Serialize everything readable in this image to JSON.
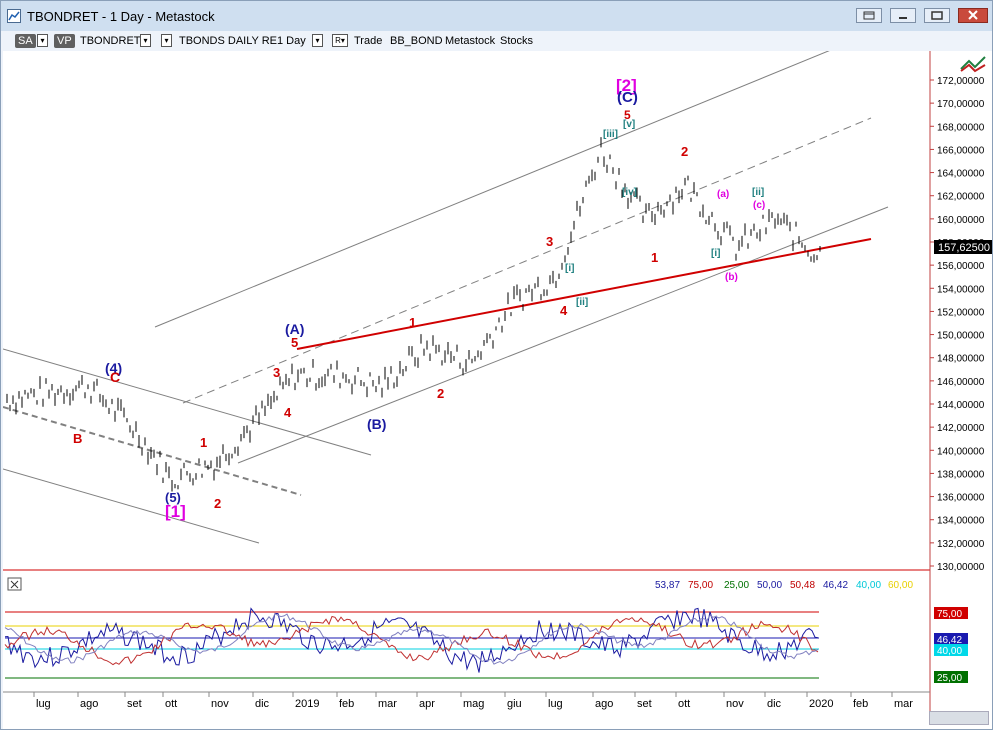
{
  "window": {
    "title": "TBONDRET - 1 Day - Metastock"
  },
  "toolbar": {
    "sa_label": "SA",
    "vp_label": "VP",
    "symbol": "TBONDRET",
    "security_name": "TBONDS DAILY RE",
    "period": "1 Day",
    "trade_label": "Trade",
    "expert": "BB_BOND",
    "app": "Metastock",
    "category": "Stocks"
  },
  "price_axis": {
    "labels": [
      "172,00000",
      "170,00000",
      "168,00000",
      "166,00000",
      "164,00000",
      "162,00000",
      "160,00000",
      "158,00000",
      "156,00000",
      "154,00000",
      "152,00000",
      "150,00000",
      "148,00000",
      "146,00000",
      "144,00000",
      "142,00000",
      "140,00000",
      "138,00000",
      "136,00000",
      "134,00000",
      "132,00000",
      "130,00000"
    ],
    "last_price": "157,62500"
  },
  "indicator_legend": [
    {
      "text": "53,87",
      "color": "#1a1aa0"
    },
    {
      "text": "75,00",
      "color": "#c00000"
    },
    {
      "text": "25,00",
      "color": "#007000"
    },
    {
      "text": "50,00",
      "color": "#1a1aa0"
    },
    {
      "text": "50,48",
      "color": "#c00000"
    },
    {
      "text": "46,42",
      "color": "#1a1aa0"
    },
    {
      "text": "40,00",
      "color": "#00c8d8"
    },
    {
      "text": "60,00",
      "color": "#e8d000"
    }
  ],
  "indicator_axis": {
    "labels": [
      {
        "text": "75,00",
        "bg": "#d00000",
        "fg": "#ffffff"
      },
      {
        "text": "46,42",
        "bg": "#1a1ab0",
        "fg": "#ffffff"
      },
      {
        "text": "40,00",
        "bg": "#00d8e8",
        "fg": "#ffffff"
      },
      {
        "text": "25,00",
        "bg": "#007000",
        "fg": "#ffffff"
      }
    ]
  },
  "time_axis": {
    "labels": [
      "lug",
      "ago",
      "set",
      "ott",
      "nov",
      "dic",
      "2019",
      "feb",
      "mar",
      "apr",
      "mag",
      "giu",
      "lug",
      "ago",
      "set",
      "ott",
      "nov",
      "dic",
      "2020",
      "feb",
      "mar"
    ]
  },
  "wave_labels": [
    {
      "text": "(4)",
      "color": "#1a1aa0"
    },
    {
      "text": "C",
      "color": "#d00000"
    },
    {
      "text": "B",
      "color": "#d00000"
    },
    {
      "text": "1",
      "color": "#d00000"
    },
    {
      "text": "(5)",
      "color": "#1a1aa0"
    },
    {
      "text": "[1]",
      "color": "#e000e0"
    },
    {
      "text": "2",
      "color": "#d00000"
    },
    {
      "text": "(A)",
      "color": "#1a1aa0"
    },
    {
      "text": "5",
      "color": "#d00000"
    },
    {
      "text": "3",
      "color": "#d00000"
    },
    {
      "text": "4",
      "color": "#d00000"
    },
    {
      "text": "(B)",
      "color": "#1a1aa0"
    },
    {
      "text": "1",
      "color": "#d00000"
    },
    {
      "text": "2",
      "color": "#d00000"
    },
    {
      "text": "3",
      "color": "#d00000"
    },
    {
      "text": "[i]",
      "color": "#208080"
    },
    {
      "text": "4",
      "color": "#d00000"
    },
    {
      "text": "[ii]",
      "color": "#208080"
    },
    {
      "text": "[2]",
      "color": "#e000e0"
    },
    {
      "text": "(C)",
      "color": "#1a1aa0"
    },
    {
      "text": "5",
      "color": "#d00000"
    },
    {
      "text": "[iii]",
      "color": "#208080"
    },
    {
      "text": "[v]",
      "color": "#208080"
    },
    {
      "text": "[iv]",
      "color": "#208080"
    },
    {
      "text": "1",
      "color": "#d00000"
    },
    {
      "text": "2",
      "color": "#d00000"
    },
    {
      "text": "(a)",
      "color": "#e000e0"
    },
    {
      "text": "[i]",
      "color": "#208080"
    },
    {
      "text": "(b)",
      "color": "#e000e0"
    },
    {
      "text": "[ii]",
      "color": "#208080"
    },
    {
      "text": "(c)",
      "color": "#e000e0"
    }
  ],
  "chart_data": {
    "type": "line",
    "x": [
      "lug",
      "ago",
      "set",
      "ott",
      "nov",
      "dic",
      "2019",
      "feb",
      "mar",
      "apr",
      "mag",
      "giu",
      "lug",
      "ago",
      "set",
      "ott",
      "nov",
      "dic",
      "2020"
    ],
    "series": [
      {
        "values": [
          144.5,
          145.6,
          142.0,
          137.5,
          139.0,
          143.0,
          146.5,
          146.5,
          145.5,
          149.0,
          147.5,
          153.0,
          155.0,
          166.0,
          160.0,
          163.0,
          157.5,
          160.0,
          157.0
        ]
      }
    ],
    "ylim": [
      130,
      173
    ],
    "grid": false
  }
}
